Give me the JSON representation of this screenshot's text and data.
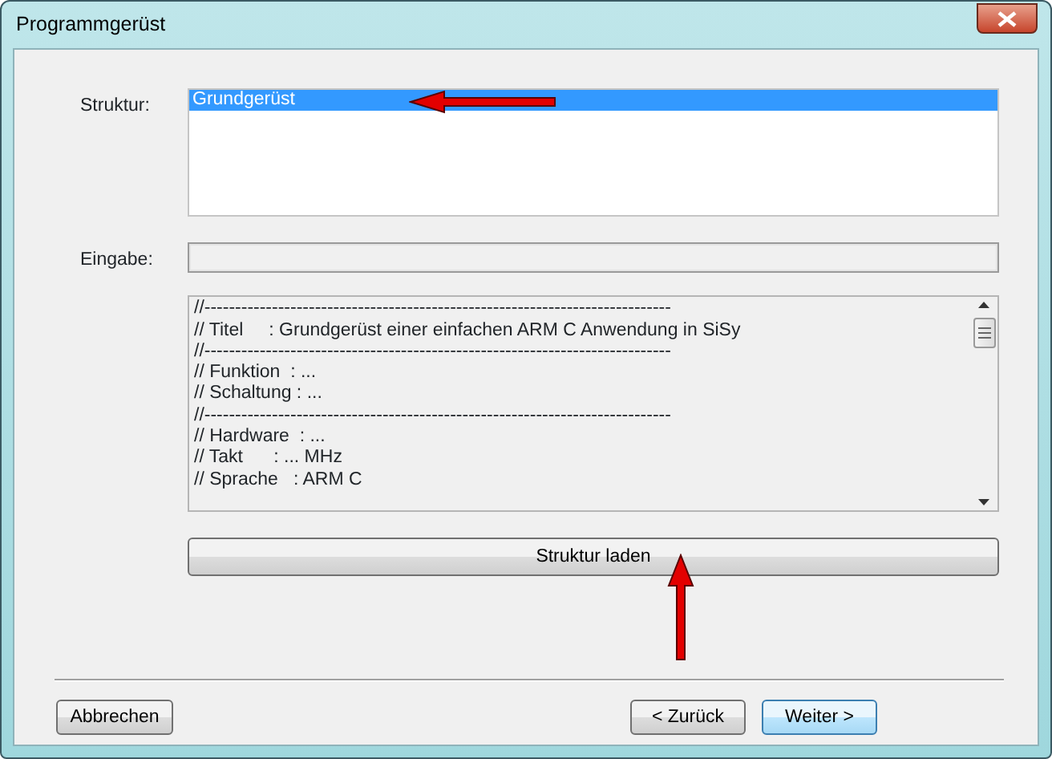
{
  "window": {
    "title": "Programmgerüst"
  },
  "structure": {
    "label": "Struktur:",
    "items": [
      {
        "text": "Grundgerüst",
        "selected": true
      }
    ]
  },
  "input": {
    "label": "Eingabe:"
  },
  "preview_lines": [
    "//----------------------------------------------------------------------------",
    "// Titel     : Grundgerüst einer einfachen ARM C Anwendung in SiSy",
    "//----------------------------------------------------------------------------",
    "// Funktion  : ...",
    "// Schaltung : ...",
    "//----------------------------------------------------------------------------",
    "// Hardware  : ...",
    "// Takt      : ... MHz",
    "// Sprache   : ARM C"
  ],
  "load_button": "Struktur laden",
  "buttons": [
    {
      "label": "Abbrechen",
      "kind": "cancel"
    },
    {
      "label": "< Zurück",
      "kind": "back"
    },
    {
      "label": "Weiter >",
      "kind": "next"
    }
  ]
}
